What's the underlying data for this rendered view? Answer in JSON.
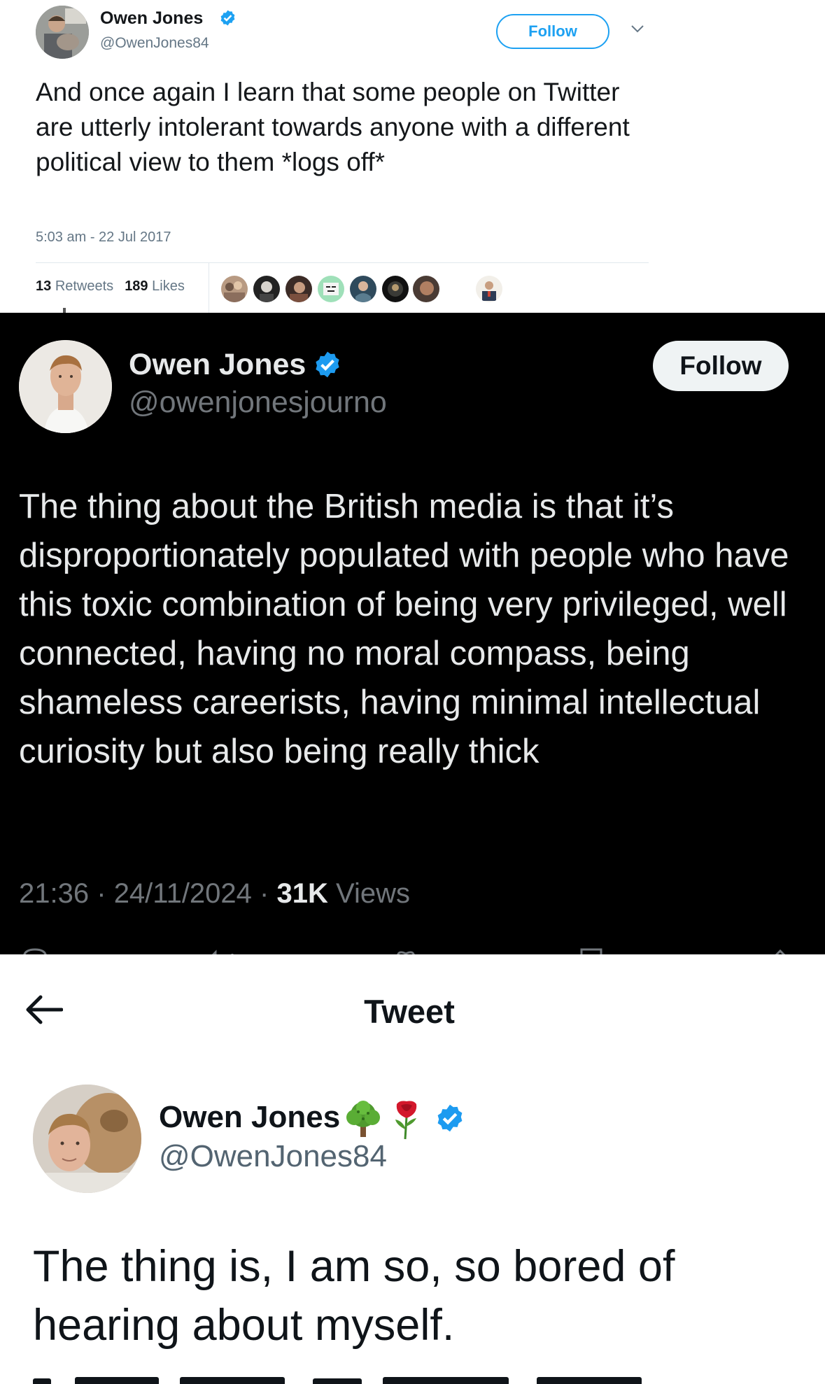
{
  "tweet1": {
    "name": "Owen Jones",
    "handle": "@OwenJones84",
    "follow_label": "Follow",
    "text": "And once again I learn that some people on Twitter are utterly intolerant towards anyone with a different political view to them *logs off*",
    "timestamp": "5:03 am - 22 Jul 2017",
    "retweets_count": "13",
    "retweets_label": "Retweets",
    "likes_count": "189",
    "likes_label": "Likes",
    "colors": {
      "accent": "#1da1f2",
      "text": "#14171a",
      "muted": "#657786"
    }
  },
  "tweet2": {
    "name": "Owen Jones",
    "handle": "@owenjonesjourno",
    "follow_label": "Follow",
    "text": "The thing about the British media is that it’s disproportionately populated with people who have this toxic combination of being very privileged, well connected, having no moral compass, being shameless careerists, having minimal intellectual curiosity but also being really thick",
    "time": "21:36",
    "date": "24/11/2024",
    "separator": "·",
    "views_count": "31K",
    "views_label": "Views",
    "colors": {
      "background": "#000000",
      "text": "#e7e9ea",
      "muted": "#71767b",
      "verified": "#1d9bf0"
    }
  },
  "tweet3": {
    "header_title": "Tweet",
    "back_icon": "arrow-left-icon",
    "name": "Owen Jones",
    "name_emojis": [
      "tree-emoji",
      "rose-emoji"
    ],
    "handle": "@OwenJones84",
    "text": "The thing is, I am so, so bored of hearing about myself.",
    "colors": {
      "text": "#0f1419",
      "muted": "#536471",
      "verified": "#1d9bf0"
    }
  }
}
